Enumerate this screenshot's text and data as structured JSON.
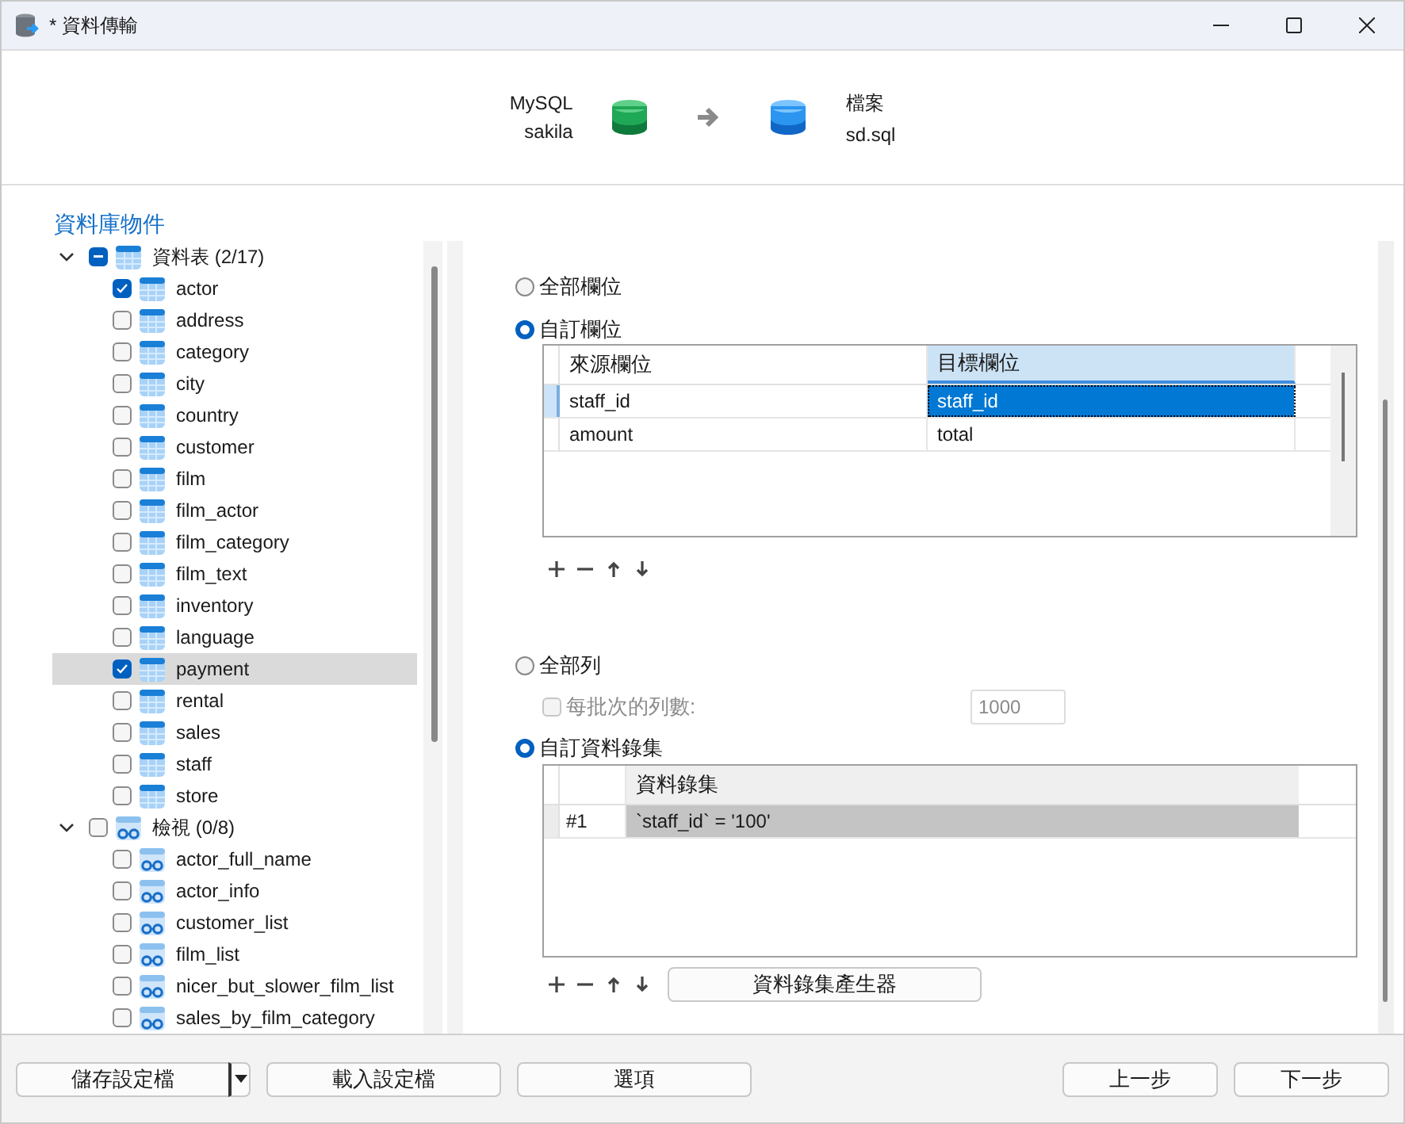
{
  "window": {
    "title": "* 資料傳輸"
  },
  "transfer": {
    "source": {
      "engine": "MySQL",
      "name": "sakila"
    },
    "target": {
      "engine": "檔案",
      "name": "sd.sql"
    }
  },
  "section_title": "資料庫物件",
  "tree": [
    {
      "label": "資料表 (2/17)",
      "kind": "table",
      "expanded": true,
      "partial": true,
      "children": [
        {
          "label": "actor",
          "checked": true,
          "selected": false
        },
        {
          "label": "address",
          "checked": false,
          "selected": false
        },
        {
          "label": "category",
          "checked": false,
          "selected": false
        },
        {
          "label": "city",
          "checked": false,
          "selected": false
        },
        {
          "label": "country",
          "checked": false,
          "selected": false
        },
        {
          "label": "customer",
          "checked": false,
          "selected": false
        },
        {
          "label": "film",
          "checked": false,
          "selected": false
        },
        {
          "label": "film_actor",
          "checked": false,
          "selected": false
        },
        {
          "label": "film_category",
          "checked": false,
          "selected": false
        },
        {
          "label": "film_text",
          "checked": false,
          "selected": false
        },
        {
          "label": "inventory",
          "checked": false,
          "selected": false
        },
        {
          "label": "language",
          "checked": false,
          "selected": false
        },
        {
          "label": "payment",
          "checked": true,
          "selected": true
        },
        {
          "label": "rental",
          "checked": false,
          "selected": false
        },
        {
          "label": "sales",
          "checked": false,
          "selected": false
        },
        {
          "label": "staff",
          "checked": false,
          "selected": false
        },
        {
          "label": "store",
          "checked": false,
          "selected": false
        }
      ]
    },
    {
      "label": "檢視 (0/8)",
      "kind": "view",
      "expanded": true,
      "partial": false,
      "children": [
        {
          "label": "actor_full_name",
          "checked": false,
          "selected": false
        },
        {
          "label": "actor_info",
          "checked": false,
          "selected": false
        },
        {
          "label": "customer_list",
          "checked": false,
          "selected": false
        },
        {
          "label": "film_list",
          "checked": false,
          "selected": false
        },
        {
          "label": "nicer_but_slower_film_list",
          "checked": false,
          "selected": false
        },
        {
          "label": "sales_by_film_category",
          "checked": false,
          "selected": false
        }
      ]
    }
  ],
  "fields": {
    "options": [
      {
        "label": "全部欄位",
        "selected": false
      },
      {
        "label": "自訂欄位",
        "selected": true
      }
    ],
    "columns": [
      {
        "label": "來源欄位",
        "selected": false
      },
      {
        "label": "目標欄位",
        "selected": true
      }
    ],
    "rows": [
      {
        "cells": [
          "staff_id",
          "staff_id"
        ],
        "selected": true
      },
      {
        "cells": [
          "amount",
          "total"
        ],
        "selected": false
      }
    ]
  },
  "records": {
    "all_option": {
      "label": "全部列",
      "selected": false
    },
    "batch": {
      "label": "每批次的列數:",
      "checked": false,
      "disabled": true,
      "value": "1000"
    },
    "custom_option": {
      "label": "自訂資料錄集",
      "selected": true
    },
    "column": "資料錄集",
    "rows": [
      {
        "index": "#1",
        "condition": "`staff_id` = '100'",
        "selected": true
      }
    ],
    "generator_button": "資料錄集產生器"
  },
  "footer": {
    "left": [
      {
        "label": "儲存設定檔",
        "kind": "split"
      },
      {
        "label": "載入設定檔",
        "kind": "plain"
      },
      {
        "label": "選項",
        "kind": "plain"
      }
    ],
    "right": [
      {
        "label": "上一步",
        "kind": "plain"
      },
      {
        "label": "下一步",
        "kind": "plain"
      }
    ]
  }
}
